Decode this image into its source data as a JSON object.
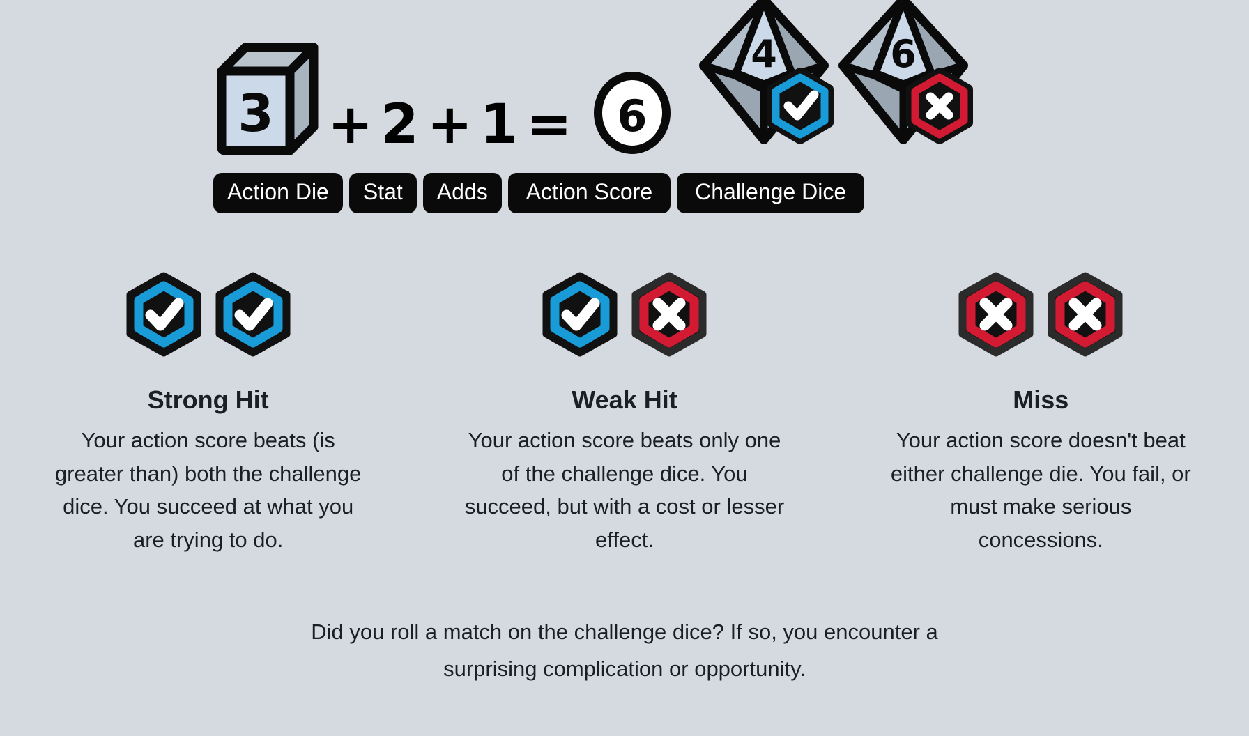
{
  "background_color": "#d5dae1",
  "colors": {
    "blue": "#199bd7",
    "red": "#d21b33",
    "black": "#111111",
    "die_face_light": "#ccd9e8",
    "die_face_mid": "#a8b4bf",
    "die_face_top": "#b9c4cc",
    "text": "#1b1f23"
  },
  "formula": {
    "action_die": {
      "value": "3",
      "icon": "cube-die-icon"
    },
    "op1": "+",
    "stat": "2",
    "op2": "+",
    "adds": "1",
    "equals": "=",
    "action_score": {
      "value": "6",
      "icon": "circle-score-icon"
    },
    "challenge_dice": {
      "die1": {
        "value": "4",
        "marker": "check-icon",
        "marker_color": "#199bd7"
      },
      "die2": {
        "value": "6",
        "marker": "x-icon",
        "marker_color": "#d21b33"
      }
    }
  },
  "labels": {
    "action_die": "Action Die",
    "stat": "Stat",
    "adds": "Adds",
    "action_score": "Action Score",
    "challenge_dice": "Challenge Dice"
  },
  "outcomes": [
    {
      "id": "strong-hit",
      "title": "Strong Hit",
      "badges": [
        {
          "icon": "check-icon",
          "color": "#199bd7"
        },
        {
          "icon": "check-icon",
          "color": "#199bd7"
        }
      ],
      "description": "Your action score beats (is greater than) both the challenge dice. You succeed at what you are trying to do."
    },
    {
      "id": "weak-hit",
      "title": "Weak Hit",
      "badges": [
        {
          "icon": "check-icon",
          "color": "#199bd7"
        },
        {
          "icon": "x-icon",
          "color": "#d21b33"
        }
      ],
      "description": "Your action score beats only one of the challenge dice. You succeed, but with a cost or lesser effect."
    },
    {
      "id": "miss",
      "title": "Miss",
      "badges": [
        {
          "icon": "x-icon",
          "color": "#d21b33"
        },
        {
          "icon": "x-icon",
          "color": "#d21b33"
        }
      ],
      "description": "Your action score doesn't beat either challenge die. You fail, or must make serious concessions."
    }
  ],
  "footer": {
    "line1": "Did you roll a match on the challenge dice? If so, you encounter a",
    "line2": "surprising complication or opportunity."
  }
}
